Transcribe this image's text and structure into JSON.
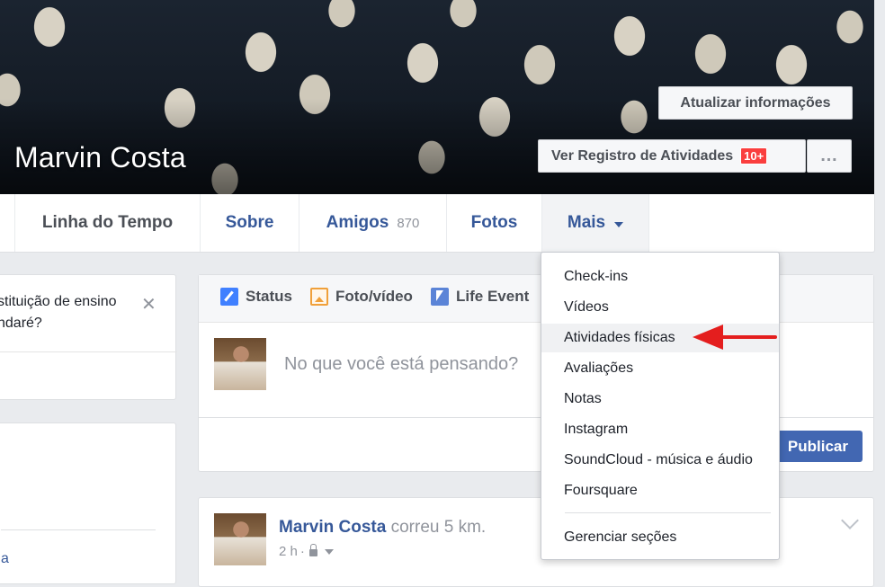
{
  "profile": {
    "name": "Marvin Costa",
    "update_info_label": "Atualizar informações",
    "activity_log_label": "Ver Registro de Atividades",
    "activity_badge": "10+",
    "more_label": "…"
  },
  "nav": {
    "tabs": [
      {
        "label": "Linha do Tempo"
      },
      {
        "label": "Sobre"
      },
      {
        "label": "Amigos",
        "count": "870"
      },
      {
        "label": "Fotos"
      },
      {
        "label": "Mais"
      }
    ]
  },
  "left": {
    "card1_line1": "stituição de ensino",
    "card1_line2": "ndaré?",
    "card1_close": "✕",
    "card2_link": "a"
  },
  "composer": {
    "tabs": [
      {
        "label": "Status",
        "icon": "pencil-icon"
      },
      {
        "label": "Foto/vídeo",
        "icon": "photo-icon"
      },
      {
        "label": "Life Event",
        "icon": "flag-icon"
      }
    ],
    "placeholder": "No que você está pensando?",
    "publish_label": "Publicar"
  },
  "post": {
    "author": "Marvin Costa",
    "action": "correu 5 km.",
    "time": "2 h",
    "separator": "·"
  },
  "dropdown": {
    "items": [
      {
        "label": "Check-ins"
      },
      {
        "label": "Vídeos"
      },
      {
        "label": "Atividades físicas"
      },
      {
        "label": "Avaliações"
      },
      {
        "label": "Notas"
      },
      {
        "label": "Instagram"
      },
      {
        "label": "SoundCloud - música e áudio"
      },
      {
        "label": "Foursquare"
      }
    ],
    "manage_label": "Gerenciar seções"
  },
  "colors": {
    "link_blue": "#365899",
    "publish_blue": "#4267b2",
    "badge_red": "#fa3e3e",
    "arrow_red": "#e41e1e"
  }
}
